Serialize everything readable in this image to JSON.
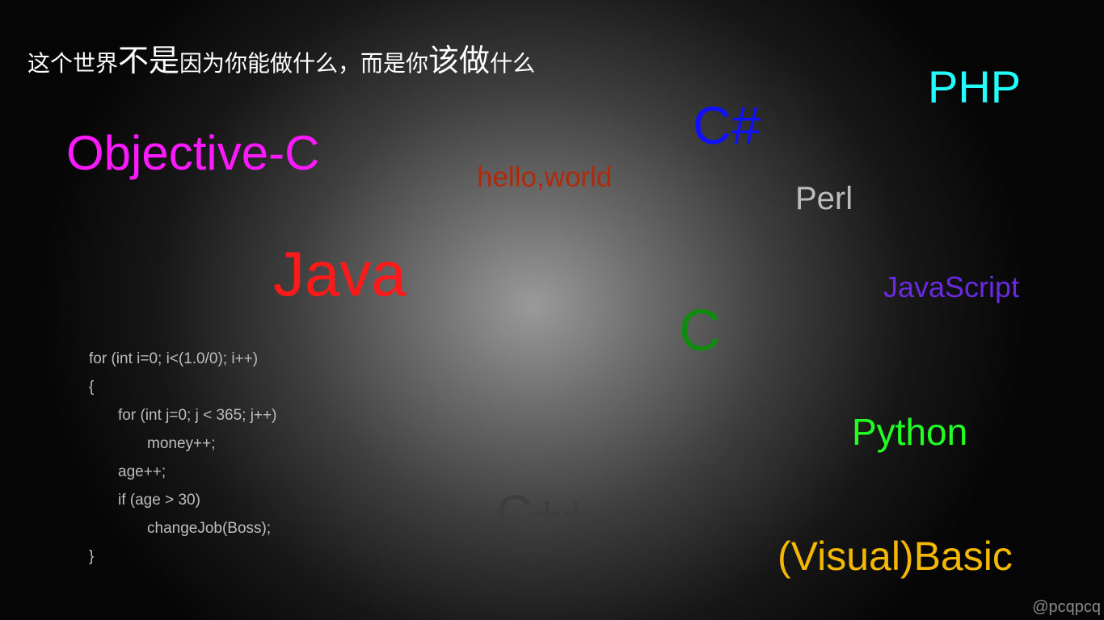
{
  "headline": {
    "part1": "这个世界",
    "part2": "不是",
    "part3": "因为你能做什么，而是你",
    "part4": "该做",
    "part5": "什么"
  },
  "words": {
    "objective_c": {
      "text": "Objective-C",
      "color": "#ff19ff"
    },
    "hello_world": {
      "text": "hello,world",
      "color": "#b02a0a"
    },
    "csharp": {
      "text": "C#",
      "color": "#1010ff"
    },
    "php": {
      "text": "PHP",
      "color": "#22ffff"
    },
    "perl": {
      "text": "Perl",
      "color": "#bdbdbd"
    },
    "java": {
      "text": "Java",
      "color": "#ff1a1a"
    },
    "javascript": {
      "text": "JavaScript",
      "color": "#6a2ae0"
    },
    "c": {
      "text": "C",
      "color": "#128a12"
    },
    "python": {
      "text": "Python",
      "color": "#22ff22"
    },
    "cpp": {
      "text": "C++",
      "color": "#3d3d3d"
    },
    "visual_basic": {
      "text": "(Visual)Basic",
      "color": "#f5b800"
    }
  },
  "code": [
    "for (int i=0; i<(1.0/0); i++)",
    "{",
    "for (int j=0; j < 365; j++)",
    "money++;",
    "age++;",
    "if (age > 30)",
    "changeJob(Boss);",
    "}"
  ],
  "watermark": "@pcqpcq"
}
